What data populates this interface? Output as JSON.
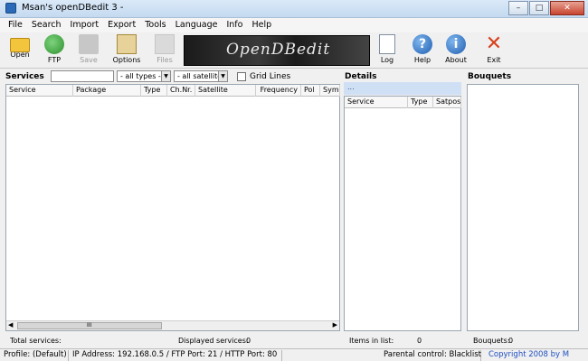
{
  "window": {
    "title": "Msan's openDBedit 3 -"
  },
  "menu": [
    "File",
    "Search",
    "Import",
    "Export",
    "Tools",
    "Language",
    "Info",
    "Help"
  ],
  "toolbar": {
    "open": "Open",
    "ftp": "FTP",
    "save": "Save",
    "options": "Options",
    "files": "Files",
    "log": "Log",
    "help": "Help",
    "about": "About",
    "exit": "Exit",
    "help_glyph": "?",
    "about_glyph": "i",
    "exit_glyph": "✕"
  },
  "logo": {
    "text": "OpenDBedit"
  },
  "services": {
    "title": "Services",
    "search_value": "",
    "types_selected": "- all types -",
    "satellites_selected": "- all satellites -",
    "grid_lines_label": "Grid Lines",
    "columns": [
      "Service",
      "Package",
      "Type",
      "Ch.Nr.",
      "Satellite",
      "Frequency",
      "Pol",
      "Symbo"
    ],
    "total_label": "Total services:",
    "displayed_label": "Displayed services:",
    "displayed_value": "0",
    "scroll_thumb": "III"
  },
  "details": {
    "title": "Details",
    "bar_text": "...",
    "columns": [
      "Service",
      "Type",
      "Satpos"
    ],
    "items_label": "Items in list:",
    "items_value": "0"
  },
  "bouquets": {
    "title": "Bouquets",
    "count_label": "Bouquets:",
    "count_value": "0"
  },
  "statusbar": {
    "profile": "Profile: (Default)",
    "network": "IP Address: 192.168.0.5 / FTP Port: 21 / HTTP Port: 80",
    "parental": "Parental control: Blacklist",
    "copyright": "Copyright 2008 by M"
  },
  "colors": {
    "accent": "#1f4fc0",
    "exit": "#d8421e",
    "info": "#1f5fb0"
  }
}
